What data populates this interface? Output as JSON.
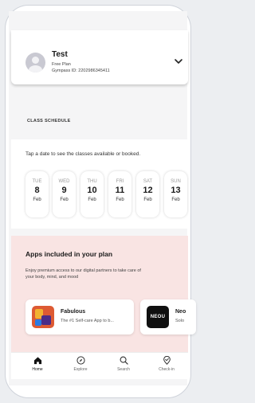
{
  "profile": {
    "name": "Test",
    "plan": "Free Plan",
    "gympass_id": "Gympass ID: 2202986345411"
  },
  "schedule": {
    "section_label": "CLASS SCHEDULE",
    "hint": "Tap a date to see the classes available or booked.",
    "days": [
      {
        "dow": "TUE",
        "num": "8",
        "mon": "Feb"
      },
      {
        "dow": "WED",
        "num": "9",
        "mon": "Feb"
      },
      {
        "dow": "THU",
        "num": "10",
        "mon": "Feb"
      },
      {
        "dow": "FRI",
        "num": "11",
        "mon": "Feb"
      },
      {
        "dow": "SAT",
        "num": "12",
        "mon": "Feb"
      },
      {
        "dow": "SUN",
        "num": "13",
        "mon": "Feb"
      }
    ]
  },
  "apps": {
    "title": "Apps included in your plan",
    "description": "Enjoy premium access to our digital partners to take care of your body, mind, and mood",
    "items": [
      {
        "name": "Fabulous",
        "subtitle": "The #1 Self-care App to b..."
      },
      {
        "name": "Neo",
        "subtitle": "Solo",
        "logo_text": "NEOU"
      }
    ]
  },
  "nav": {
    "items": [
      {
        "label": "Home"
      },
      {
        "label": "Explore"
      },
      {
        "label": "Search"
      },
      {
        "label": "Check-in"
      }
    ]
  },
  "colors": {
    "apps_bg": "#f9e4e3",
    "active_nav": "#111111"
  }
}
